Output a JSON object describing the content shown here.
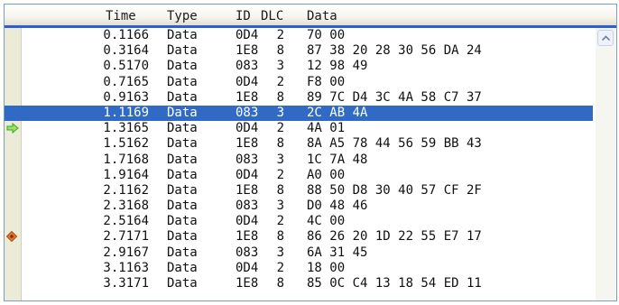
{
  "columns": {
    "time": "Time",
    "type": "Type",
    "id": "ID",
    "dlc": "DLC",
    "data": "Data"
  },
  "rows": [
    {
      "time": "0.1166",
      "type": "Data",
      "id": "0D4",
      "dlc": "2",
      "data": "70 00"
    },
    {
      "time": "0.3164",
      "type": "Data",
      "id": "1E8",
      "dlc": "8",
      "data": "87 38 20 28 30 56 DA 24"
    },
    {
      "time": "0.5170",
      "type": "Data",
      "id": "083",
      "dlc": "3",
      "data": "12 98 49"
    },
    {
      "time": "0.7165",
      "type": "Data",
      "id": "0D4",
      "dlc": "2",
      "data": "F8 00"
    },
    {
      "time": "0.9163",
      "type": "Data",
      "id": "1E8",
      "dlc": "8",
      "data": "89 7C D4 3C 4A 58 C7 37"
    },
    {
      "time": "1.1169",
      "type": "Data",
      "id": "083",
      "dlc": "3",
      "data": "2C AB 4A",
      "selected": true
    },
    {
      "time": "1.3165",
      "type": "Data",
      "id": "0D4",
      "dlc": "2",
      "data": "4A 01",
      "marker": "current-position-arrow-icon"
    },
    {
      "time": "1.5162",
      "type": "Data",
      "id": "1E8",
      "dlc": "8",
      "data": "8A A5 78 44 56 59 BB 43"
    },
    {
      "time": "1.7168",
      "type": "Data",
      "id": "083",
      "dlc": "3",
      "data": "1C 7A 48"
    },
    {
      "time": "1.9164",
      "type": "Data",
      "id": "0D4",
      "dlc": "2",
      "data": "A0 00"
    },
    {
      "time": "2.1162",
      "type": "Data",
      "id": "1E8",
      "dlc": "8",
      "data": "88 50 D8 30 40 57 CF 2F"
    },
    {
      "time": "2.3168",
      "type": "Data",
      "id": "083",
      "dlc": "3",
      "data": "D0 48 46"
    },
    {
      "time": "2.5164",
      "type": "Data",
      "id": "0D4",
      "dlc": "2",
      "data": "4C 00"
    },
    {
      "time": "2.7171",
      "type": "Data",
      "id": "1E8",
      "dlc": "8",
      "data": "86 26 20 1D 22 55 E7 17",
      "marker": "breakpoint-icon"
    },
    {
      "time": "2.9167",
      "type": "Data",
      "id": "083",
      "dlc": "3",
      "data": "6A 31 45"
    },
    {
      "time": "3.1163",
      "type": "Data",
      "id": "0D4",
      "dlc": "2",
      "data": "18 00"
    },
    {
      "time": "3.3171",
      "type": "Data",
      "id": "1E8",
      "dlc": "8",
      "data": "85 0C C4 13 18 54 ED 11"
    }
  ],
  "colors": {
    "selection": "#316ac5",
    "header_accent": "#2c5fd1",
    "gutter": "#ecebd8",
    "arrow_marker": "#33aa22",
    "breakpoint_marker": "#b04a1a"
  }
}
